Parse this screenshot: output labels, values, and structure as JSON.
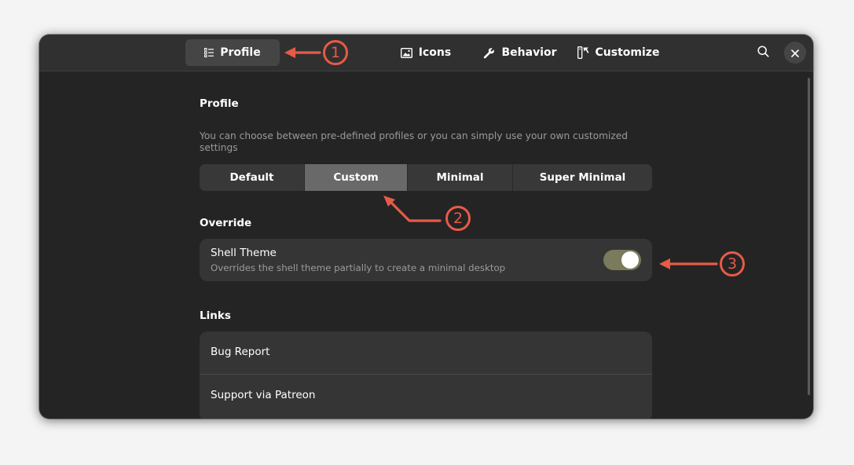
{
  "header": {
    "tabs": [
      {
        "label": "Profile",
        "icon": "list-icon",
        "active": true
      },
      {
        "label": "Icons",
        "icon": "image-icon",
        "active": false
      },
      {
        "label": "Behavior",
        "icon": "wrench-icon",
        "active": false
      },
      {
        "label": "Customize",
        "icon": "customize-icon",
        "active": false
      }
    ],
    "search_icon": "search-icon",
    "close_icon": "close-icon"
  },
  "profile": {
    "title": "Profile",
    "description": "You can choose between pre-defined profiles or you can simply use your own customized settings",
    "options": [
      {
        "label": "Default",
        "selected": false
      },
      {
        "label": "Custom",
        "selected": true
      },
      {
        "label": "Minimal",
        "selected": false
      },
      {
        "label": "Super Minimal",
        "selected": false
      }
    ]
  },
  "override": {
    "title": "Override",
    "shell_theme": {
      "title": "Shell Theme",
      "subtitle": "Overrides the shell theme partially to create a minimal desktop",
      "enabled": true
    }
  },
  "links": {
    "title": "Links",
    "items": [
      {
        "label": "Bug Report"
      },
      {
        "label": "Support via Patreon"
      }
    ]
  },
  "annotations": [
    {
      "number": "1"
    },
    {
      "number": "2"
    },
    {
      "number": "3"
    }
  ],
  "colors": {
    "annotation": "#e85a48",
    "switch_on": "#7a7a5c",
    "selected_segment": "#696969"
  }
}
